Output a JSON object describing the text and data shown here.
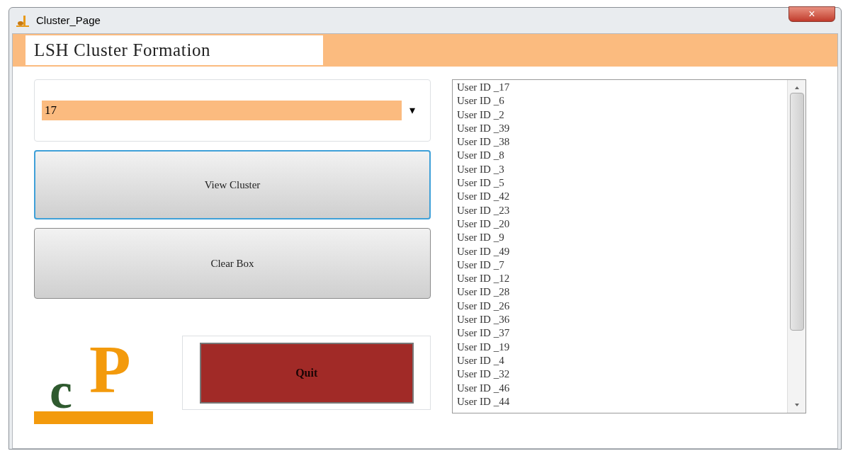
{
  "window": {
    "title": "Cluster_Page",
    "close": "×"
  },
  "header": {
    "title": "LSH Cluster Formation"
  },
  "cluster_select": {
    "value": "17",
    "arrow": "▾"
  },
  "buttons": [
    {
      "label": "View Cluster",
      "focused": true
    },
    {
      "label": "Clear Box",
      "focused": false
    }
  ],
  "logo": {
    "letters": [
      "c",
      "P"
    ]
  },
  "quit_button": {
    "label": "Quit"
  },
  "user_list": {
    "items": [
      "User ID _17",
      "User ID _6",
      "User ID _2",
      "User ID _39",
      "User ID _38",
      "User ID _8",
      "User ID _3",
      "User ID _5",
      "User ID _42",
      "User ID _23",
      "User ID _20",
      "User ID _9",
      "User ID _49",
      "User ID _7",
      "User ID _12",
      "User ID _28",
      "User ID _26",
      "User ID _36",
      "User ID _37",
      "User ID _19",
      "User ID _4",
      "User ID _32",
      "User ID _46",
      "User ID _44"
    ]
  }
}
